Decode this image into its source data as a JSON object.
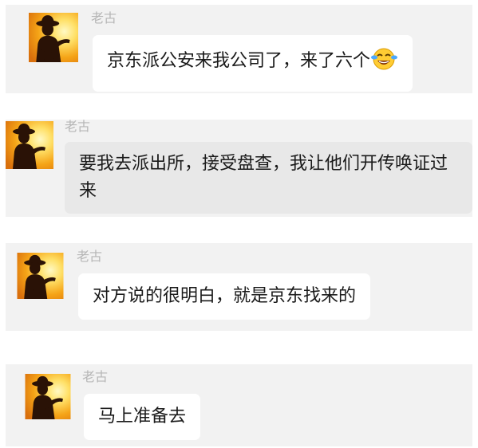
{
  "colors": {
    "card_background": "#f2f2f2",
    "bubble_white": "#ffffff",
    "bubble_grey": "#e8e8e8",
    "sender_name": "#b6b6b6",
    "message_text": "#1a1a1a",
    "avatar_sunset_bright": "#fff7b0",
    "avatar_sunset_orange": "#f3a21a"
  },
  "messages": [
    {
      "sender": "老古",
      "text": "京东派公安来我公司了，来了六个",
      "emoji": "laughing-tears-emoji"
    },
    {
      "sender": "老古",
      "text": "要我去派出所，接受盘查，我让他们开传唤证过来"
    },
    {
      "sender": "老古",
      "text": "对方说的很明白，就是京东找来的"
    },
    {
      "sender": "老古",
      "text": "马上准备去"
    }
  ]
}
